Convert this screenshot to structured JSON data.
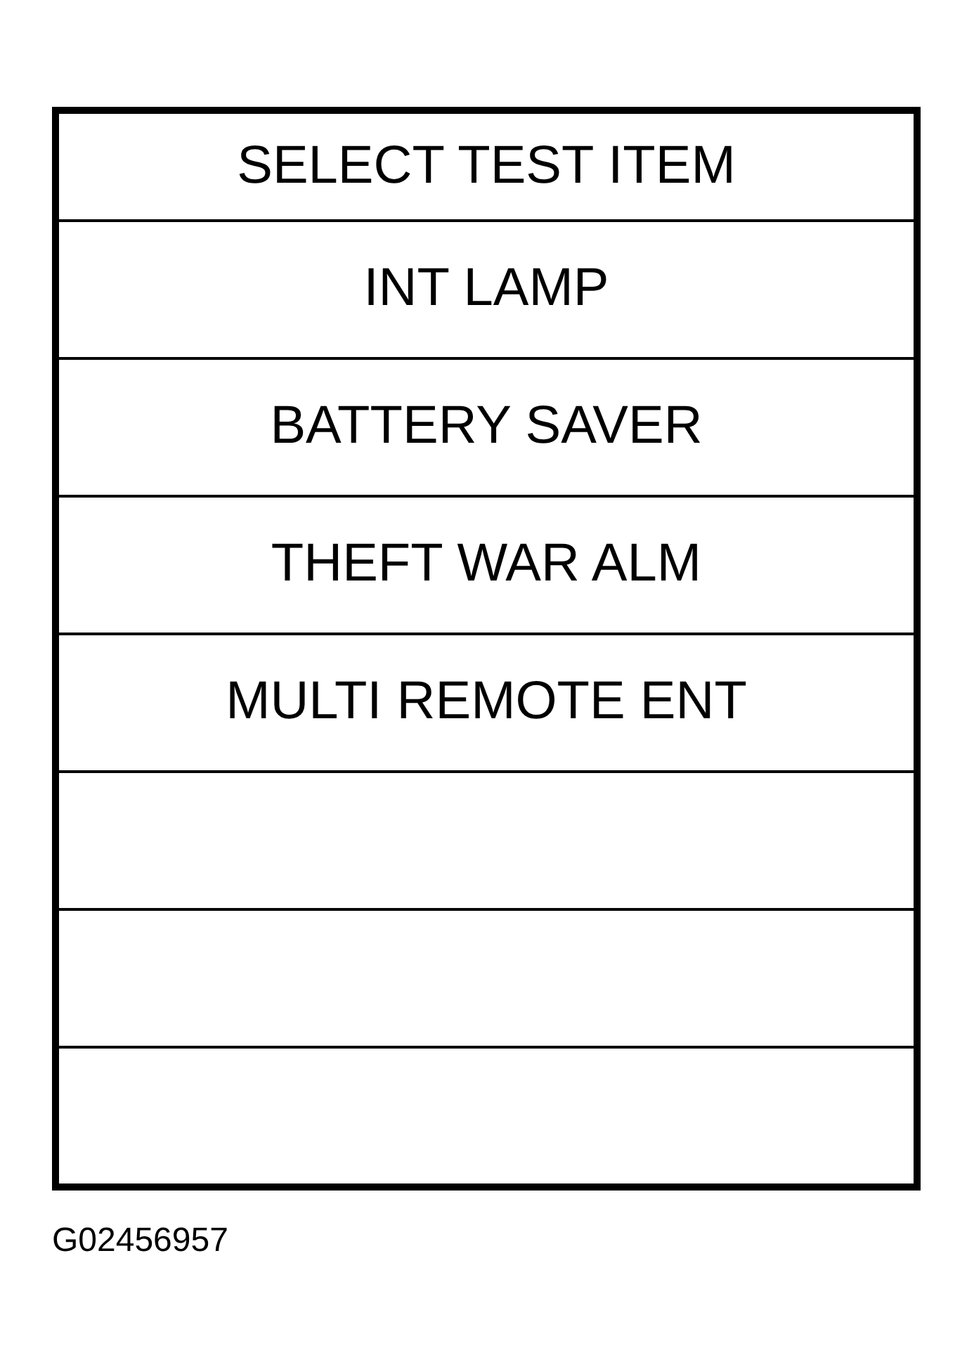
{
  "screen": {
    "rows": [
      {
        "kind": "title",
        "text": "SELECT TEST ITEM"
      },
      {
        "kind": "item",
        "text": "INT LAMP"
      },
      {
        "kind": "item",
        "text": "BATTERY SAVER"
      },
      {
        "kind": "item",
        "text": "THEFT WAR ALM"
      },
      {
        "kind": "item",
        "text": "MULTI REMOTE ENT"
      },
      {
        "kind": "blank"
      },
      {
        "kind": "blank"
      },
      {
        "kind": "blank"
      }
    ]
  },
  "figure_id": "G02456957"
}
